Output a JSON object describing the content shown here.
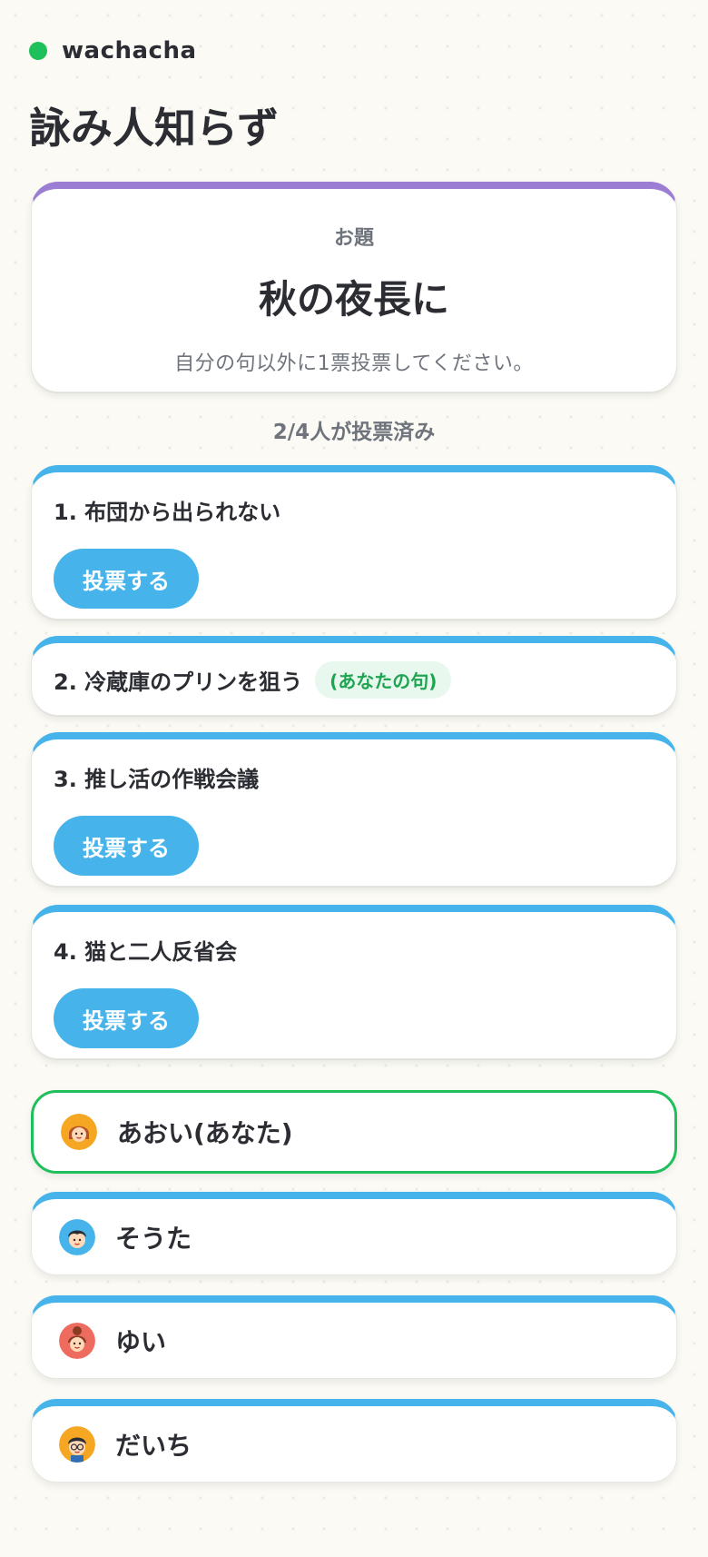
{
  "brand": {
    "name": "wachacha",
    "dot_color": "#1fbf5b"
  },
  "page": {
    "title": "詠み人知らず"
  },
  "prompt": {
    "label": "お題",
    "text": "秋の夜長に",
    "hint": "自分の句以外に1票投票してください。"
  },
  "vote_status": "2/4人が投票済み",
  "entries": [
    {
      "title": "1. 布団から出られない",
      "vote_label": "投票する"
    },
    {
      "title": "2. 冷蔵庫のプリンを狙う",
      "own_badge": "(あなたの句)"
    },
    {
      "title": "3. 推し活の作戦会議",
      "vote_label": "投票する"
    },
    {
      "title": "4. 猫と二人反省会",
      "vote_label": "投票する"
    }
  ],
  "players": [
    {
      "name": "あおい(あなた)",
      "avatar_color": "#f5a623",
      "avatar_icon": "girl-avatar-icon"
    },
    {
      "name": "そうた",
      "avatar_color": "#46b4ea",
      "avatar_icon": "boy-avatar-icon"
    },
    {
      "name": "ゆい",
      "avatar_color": "#ee6b60",
      "avatar_icon": "girl-bun-avatar-icon"
    },
    {
      "name": "だいち",
      "avatar_color": "#f5a623",
      "avatar_icon": "boy-glasses-avatar-icon"
    }
  ],
  "colors": {
    "accent_blue": "#46b4ea",
    "accent_purple": "#9b7ed4",
    "accent_green": "#1fbf5b"
  }
}
